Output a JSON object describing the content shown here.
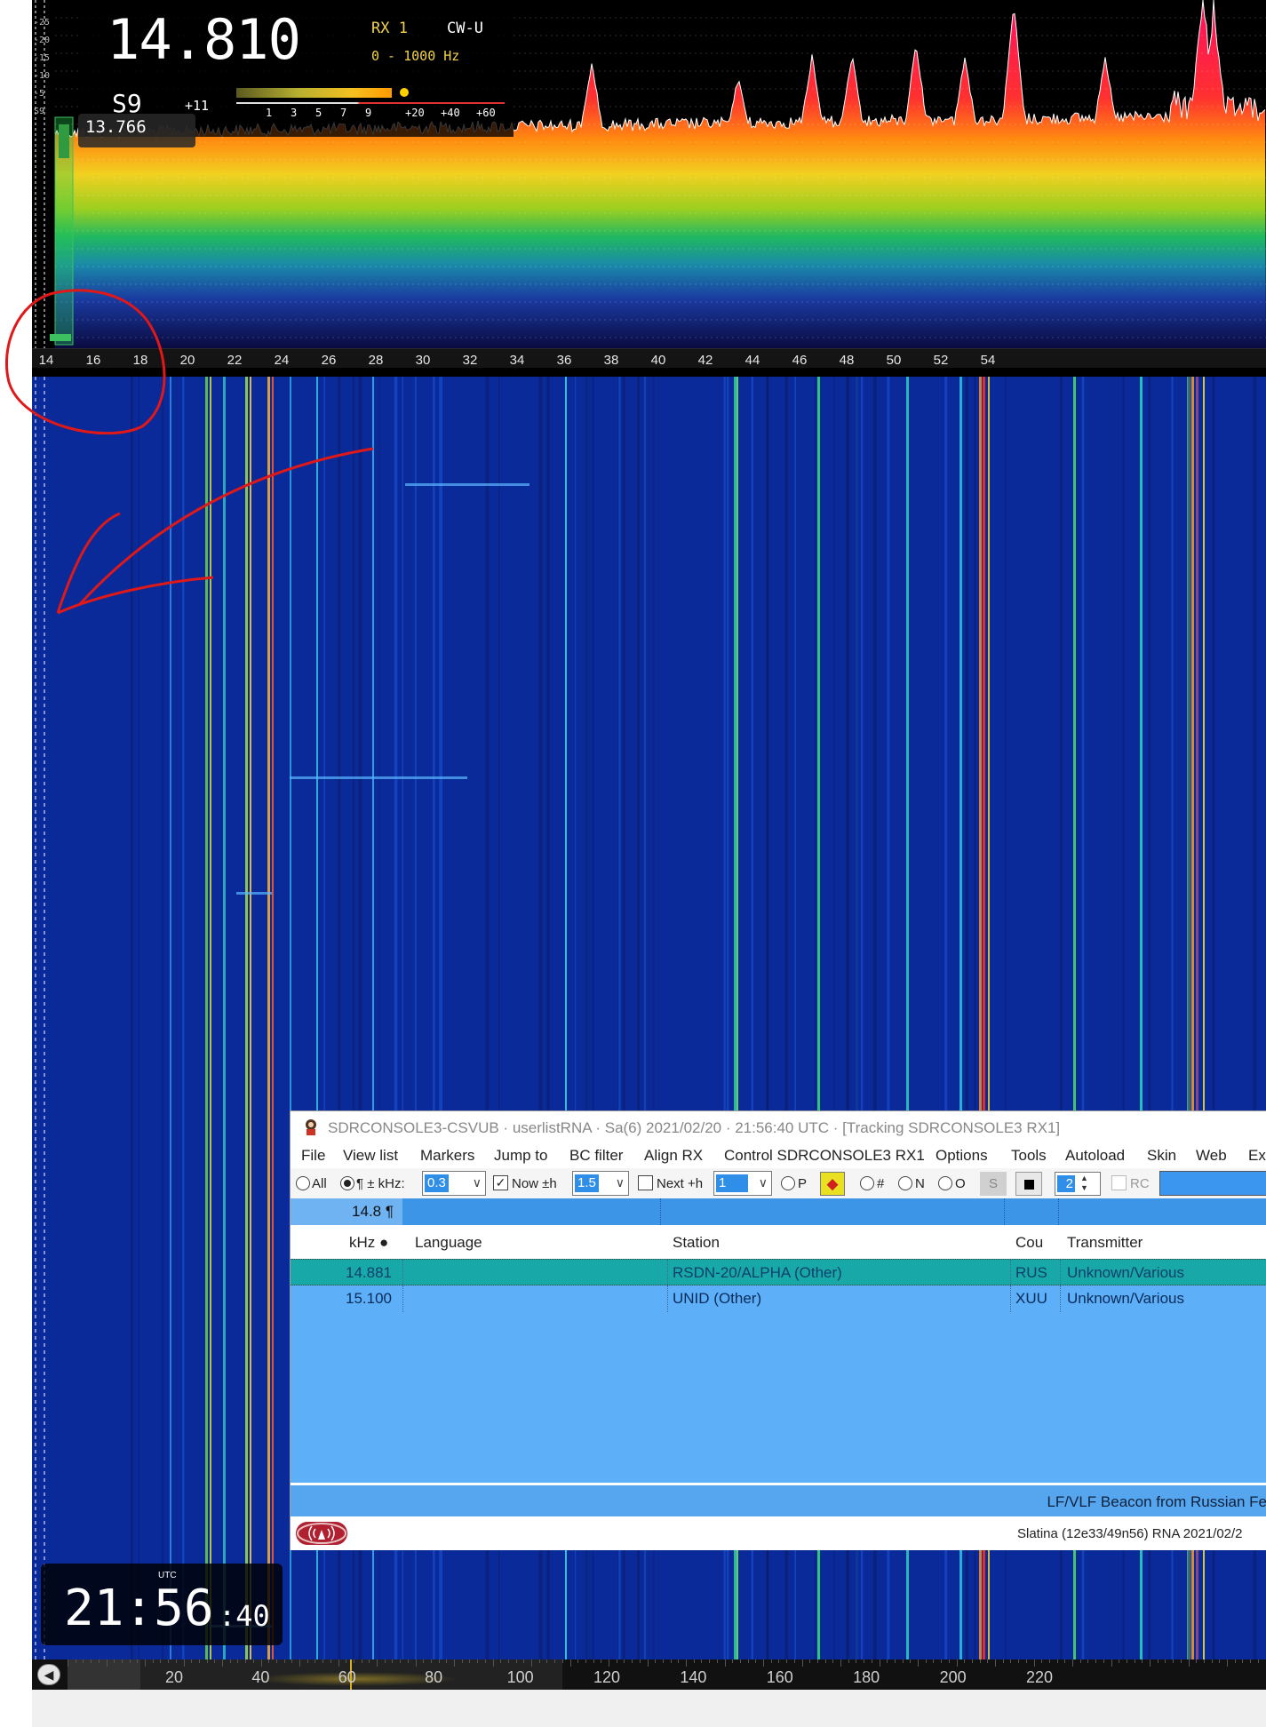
{
  "spectrum": {
    "frequency": "14.810",
    "rx": "RX 1",
    "mode": "CW-U",
    "bandwidth": "0 - 1000 Hz",
    "smeter": "S9",
    "smeter_over": "+11",
    "smeter_ticks": [
      "1",
      "3",
      "5",
      "7",
      "9",
      "+20",
      "+40",
      "+60"
    ],
    "sub_frequency": "13.766",
    "left_scale": [
      "-25",
      "-20",
      "-15",
      "-10",
      "-5",
      "S9"
    ],
    "freq_scale": [
      "14",
      "16",
      "18",
      "20",
      "22",
      "24",
      "26",
      "28",
      "30",
      "32",
      "34",
      "36",
      "38",
      "40",
      "42",
      "44",
      "46",
      "48",
      "50",
      "52",
      "54"
    ]
  },
  "clock": {
    "utc_label": "UTC",
    "hours_minutes": "21:56",
    "seconds": ":40"
  },
  "bottom_scale": {
    "labels": [
      "20",
      "40",
      "60",
      "80",
      "100",
      "120",
      "140",
      "160",
      "180",
      "200",
      "220"
    ]
  },
  "eibi": {
    "title": "SDRCONSOLE3-CSVUB · userlistRNA · Sa(6) 2021/02/20 · 21:56:40 UTC · [Tracking SDRCONSOLE3 RX1]",
    "menu": [
      "File",
      "View list",
      "Markers",
      "Jump to",
      "BC filter",
      "Align RX",
      "Control SDRCONSOLE3 RX1",
      "Options",
      "Tools",
      "Autoload",
      "Skin",
      "Web",
      "Ext"
    ],
    "toolbar": {
      "all_label": "All",
      "khz_label": "¶ ± kHz:",
      "khz_value": "0.3",
      "now_label": "Now ±h",
      "now_value": "1.5",
      "next_label": "Next +h",
      "next_value": "1",
      "p_label": "P",
      "hash_label": "#",
      "n_label": "N",
      "o_label": "O",
      "s_label": "S",
      "spin_value": "2",
      "rc_label": "RC"
    },
    "filter_value": "14.8 ¶",
    "headers": [
      "kHz ●",
      "Language",
      "Station",
      "Cou",
      "Transmitter"
    ],
    "rows": [
      {
        "khz": "14.881",
        "language": "",
        "station": "RSDN-20/ALPHA (Other)",
        "country": "RUS",
        "transmitter": "Unknown/Various"
      },
      {
        "khz": "15.100",
        "language": "",
        "station": "UNID (Other)",
        "country": "XUU",
        "transmitter": "Unknown/Various"
      }
    ],
    "description": "LF/VLF Beacon from Russian Fe",
    "status": "Slatina (12e33/49n56) RNA 2021/02/2"
  },
  "colors": {
    "selected_row": "#18a8a8",
    "list_background": "#5db0f7",
    "filter_row": "#3d95e8",
    "annotation_red": "#e01818"
  }
}
